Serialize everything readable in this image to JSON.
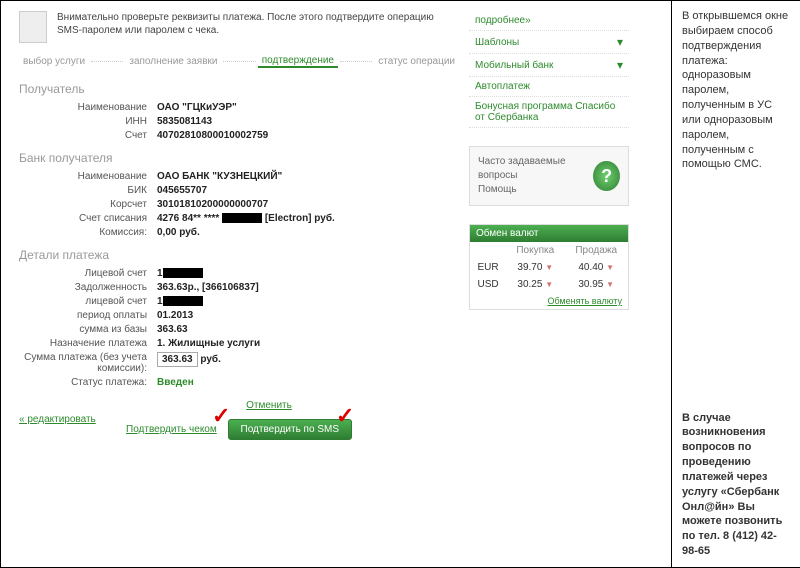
{
  "notice": "Внимательно проверьте реквизиты платежа. После этого подтвердите операцию SMS-паролем или паролем с чека.",
  "steps": {
    "s1": "выбор услуги",
    "s2": "заполнение заявки",
    "s3": "подтверждение",
    "s4": "статус операции"
  },
  "sec1": "Получатель",
  "recipient": {
    "name_l": "Наименование",
    "name": "ОАО \"ГЦКиУЭР\"",
    "inn_l": "ИНН",
    "inn": "5835081143",
    "acct_l": "Счет",
    "acct": "40702810800010002759"
  },
  "sec2": "Банк получателя",
  "bank": {
    "name_l": "Наименование",
    "name": "ОАО БАНК \"КУЗНЕЦКИЙ\"",
    "bik_l": "БИК",
    "bik": "045655707",
    "korr_l": "Корсчет",
    "korr": "30101810200000000707",
    "write_l": "Счет списания",
    "write": "4276 84** **** ",
    "write2": " [Electron]  руб.",
    "fee_l": "Комиссия:",
    "fee": "0,00 руб."
  },
  "sec3": "Детали платежа",
  "det": {
    "lic1_l": "Лицевой счет",
    "lic1": "1",
    "debt_l": "Задолженность",
    "debt": "363.63р., [366106837]",
    "lic2_l": "лицевой счет",
    "lic2": "1",
    "period_l": "период оплаты",
    "period": "01.2013",
    "base_l": "сумма из базы",
    "base": "363.63",
    "purpose_l": "Назначение платежа",
    "purpose": "1. Жилищные услуги",
    "amt_l": "Сумма платежа (без учета комиссии):",
    "amt": "363.63",
    "amt_cur": " руб.",
    "status_l": "Статус платежа:",
    "status": "Введен"
  },
  "actions": {
    "edit": "« редактировать",
    "cancel": "Отменить",
    "cheque": "Подтвердить чеком",
    "sms": "Подтвердить по SMS"
  },
  "side_menu": {
    "more": "подробнее»",
    "tpl": "Шаблоны",
    "mbank": "Мобильный банк",
    "auto": "Автоплатеж",
    "bonus": "Бонусная программа Спасибо от Сбербанка"
  },
  "faq": {
    "q": "Часто задаваемые вопросы",
    "h": "Помощь"
  },
  "curr": {
    "h": "Обмен валют",
    "buy": "Покупка",
    "sell": "Продажа",
    "rows": [
      {
        "c": "EUR",
        "b": "39.70",
        "s": "40.40"
      },
      {
        "c": "USD",
        "b": "30.25",
        "s": "30.95"
      }
    ],
    "link": "Обменять валюту"
  },
  "rtext": {
    "top": "В открывшемся окне выбираем способ подтверждения платежа: одноразовым паролем, полученным в УС или одноразовым паролем, полученным с помощью СМС.",
    "bot": "В случае возникновения вопросов по проведению платежей через услугу «Сбербанк Онл@йн» Вы можете позвонить по тел. 8 (412) 42-98-65"
  }
}
